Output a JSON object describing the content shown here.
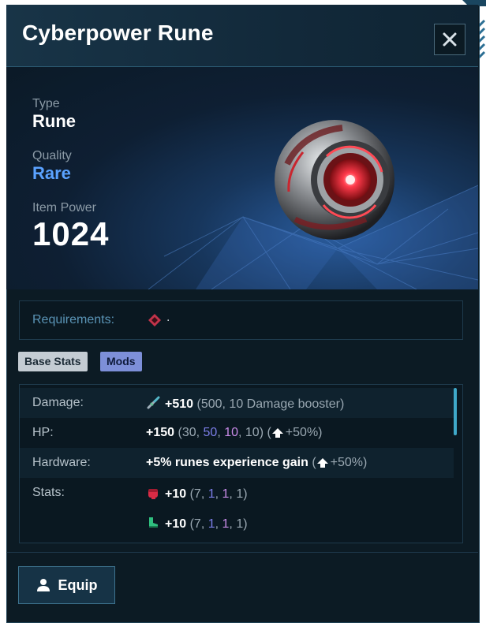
{
  "window": {
    "title": "Cyberpower Rune",
    "close_glyph": "✕"
  },
  "item": {
    "type_label": "Type",
    "type_value": "Rune",
    "quality_label": "Quality",
    "quality_value": "Rare",
    "power_label": "Item Power",
    "power_value": "1024"
  },
  "requirements": {
    "label": "Requirements:",
    "icon": "red-diamond-icon",
    "trailing": "."
  },
  "tabs": [
    {
      "label": "Base Stats",
      "active": true
    },
    {
      "label": "Mods",
      "active": false
    }
  ],
  "stats": {
    "damage": {
      "label": "Damage:",
      "icon": "dagger-icon",
      "value": "+510",
      "detail": "(500, 10 Damage booster)"
    },
    "hp": {
      "label": "HP:",
      "value": "+150",
      "open": "(30, ",
      "v2": "50",
      "sep1": ", ",
      "v3": "10",
      "sep2": ", ",
      "v4": "10",
      "close": ")",
      "bonus_open": "(",
      "bonus_icon": "up-arrow-icon",
      "bonus": "+50%)"
    },
    "hardware": {
      "label": "Hardware:",
      "value": "+5% runes experience gain",
      "bonus_open": "(",
      "bonus_icon": "up-arrow-icon",
      "bonus": "+50%)"
    },
    "stats_row": {
      "label": "Stats:",
      "icon": "fist-icon",
      "value": "+10",
      "open": "(7, ",
      "v2": "1",
      "sep1": ", ",
      "v3": "1",
      "sep2": ", ",
      "v4": "1",
      "close": ")"
    },
    "stats_row2": {
      "icon": "boot-icon",
      "value": "+10",
      "open": "(7, ",
      "v2": "1",
      "sep1": ", ",
      "v3": "1",
      "sep2": ", ",
      "v4": "1",
      "close": ")"
    }
  },
  "footer": {
    "equip_label": "Equip",
    "equip_icon": "person-icon"
  },
  "colors": {
    "accent_blue": "#5aa2ff",
    "panel": "#0c1b24",
    "value_blue": "#7c7ee8",
    "value_purple": "#c98be8"
  }
}
